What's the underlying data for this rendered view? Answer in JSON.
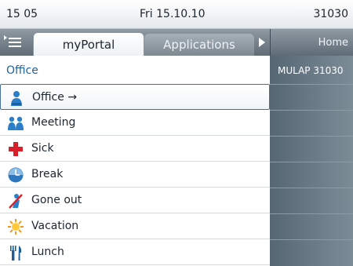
{
  "status_bar": {
    "time": "15 05",
    "date": "Fri 15.10.10",
    "extension": "31030"
  },
  "tabs": [
    {
      "label": "myPortal",
      "selected": true
    },
    {
      "label": "Applications",
      "selected": false
    }
  ],
  "panel": {
    "title": "Office",
    "items": [
      {
        "label": "Office →",
        "icon": "person-icon",
        "selected": true
      },
      {
        "label": "Meeting",
        "icon": "meeting-icon"
      },
      {
        "label": "Sick",
        "icon": "red-cross-icon"
      },
      {
        "label": "Break",
        "icon": "clock-icon"
      },
      {
        "label": "Gone out",
        "icon": "gone-out-icon"
      },
      {
        "label": "Vacation",
        "icon": "sun-icon"
      },
      {
        "label": "Lunch",
        "icon": "cutlery-icon"
      }
    ]
  },
  "right_panel": {
    "title": "Home",
    "subtitle": "MULAP 31030"
  },
  "colors": {
    "accent_blue": "#1e62a0",
    "panel_gray": "#6d7e8a",
    "cross_red": "#d8202a",
    "sun_orange": "#f39a1e"
  }
}
